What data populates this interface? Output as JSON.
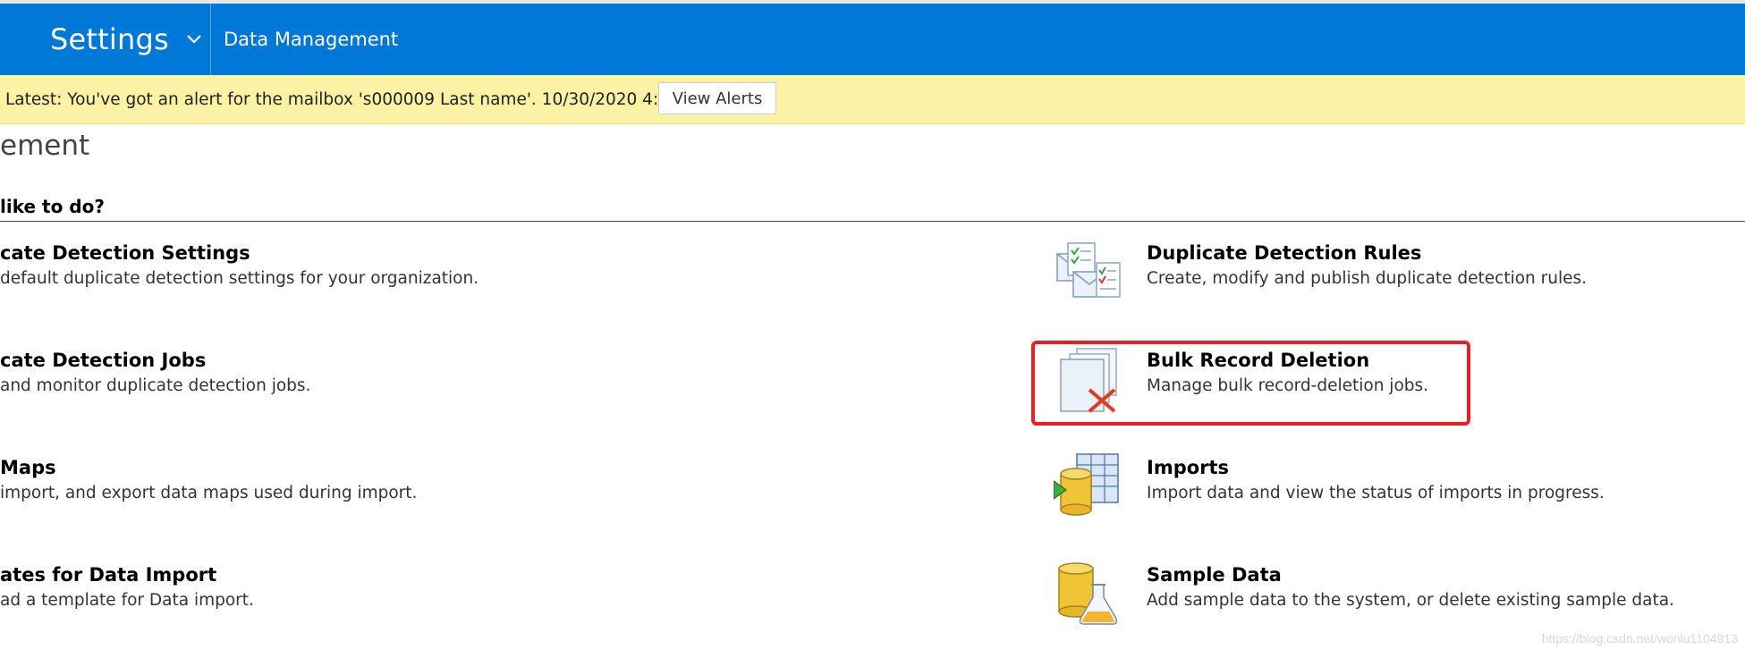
{
  "navbar": {
    "app_name": "Settings",
    "area": "Data Management",
    "color": "#0078d7"
  },
  "alert": {
    "text": "Latest: You've got an alert for the mailbox 's000009 Last name'. 10/30/2020 4:52 PM",
    "button_label": "View Alerts",
    "color": "#fbf2a5"
  },
  "page": {
    "title": "ement",
    "question": "like to do?"
  },
  "left_items": [
    {
      "title": "cate Detection Settings",
      "desc": "default duplicate detection settings for your organization."
    },
    {
      "title": "cate Detection Jobs",
      "desc": "and monitor duplicate detection jobs."
    },
    {
      "title": "Maps",
      "desc": "import, and export data maps used during import."
    },
    {
      "title": "ates for Data Import",
      "desc": "ad a template for Data import."
    }
  ],
  "right_items": [
    {
      "title": "Duplicate Detection Rules",
      "desc": "Create, modify and publish duplicate detection rules.",
      "icon": "duplicate-detection-rules-icon"
    },
    {
      "title": "Bulk Record Deletion",
      "desc": "Manage bulk record-deletion jobs.",
      "icon": "bulk-record-deletion-icon"
    },
    {
      "title": "Imports",
      "desc": "Import data and view the status of imports in progress.",
      "icon": "imports-icon"
    },
    {
      "title": "Sample Data",
      "desc": "Add sample data to the system, or delete existing sample data.",
      "icon": "sample-data-icon"
    }
  ],
  "highlight_color": "#ee1c24",
  "watermark": "https://blog.csdn.net/wonlu1104913"
}
